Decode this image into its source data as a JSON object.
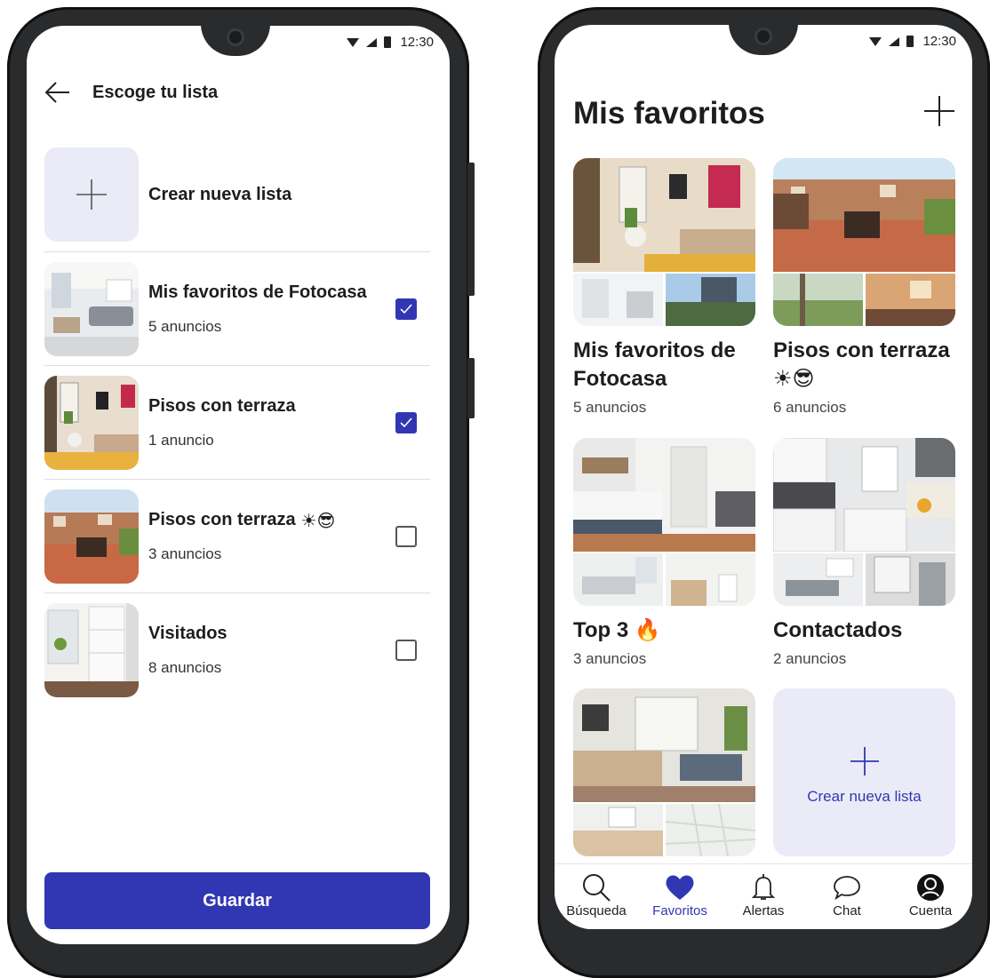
{
  "status": {
    "time": "12:30"
  },
  "choose": {
    "title": "Escoge tu lista",
    "create_label": "Crear nueva lista",
    "lists": [
      {
        "name": "Mis favoritos de Fotocasa",
        "count": "5 anuncios",
        "checked": true,
        "emoji": ""
      },
      {
        "name": "Pisos con terraza",
        "count": "1 anuncio",
        "checked": true,
        "emoji": ""
      },
      {
        "name": "Pisos con terraza",
        "count": "3 anuncios",
        "checked": false,
        "emoji": "☀😎"
      },
      {
        "name": "Visitados",
        "count": "8 anuncios",
        "checked": false,
        "emoji": ""
      }
    ],
    "save_label": "Guardar"
  },
  "favorites": {
    "title": "Mis favoritos",
    "cards": [
      {
        "name": "Mis favoritos de Fotocasa",
        "count": "5 anuncios"
      },
      {
        "name": "Pisos con terraza ☀😎",
        "count": "6 anuncios"
      },
      {
        "name": "Top 3 🔥",
        "count": "3 anuncios"
      },
      {
        "name": "Contactados",
        "count": "2 anuncios"
      }
    ],
    "create_label": "Crear nueva lista"
  },
  "tabs": [
    {
      "label": "Búsqueda",
      "icon": "search-icon"
    },
    {
      "label": "Favoritos",
      "icon": "heart-icon"
    },
    {
      "label": "Alertas",
      "icon": "bell-icon"
    },
    {
      "label": "Chat",
      "icon": "chat-icon"
    },
    {
      "label": "Cuenta",
      "icon": "account-icon"
    }
  ],
  "colors": {
    "accent": "#3137b2",
    "tile_bg": "#ebebf7",
    "frame": "#2a2b2d"
  }
}
